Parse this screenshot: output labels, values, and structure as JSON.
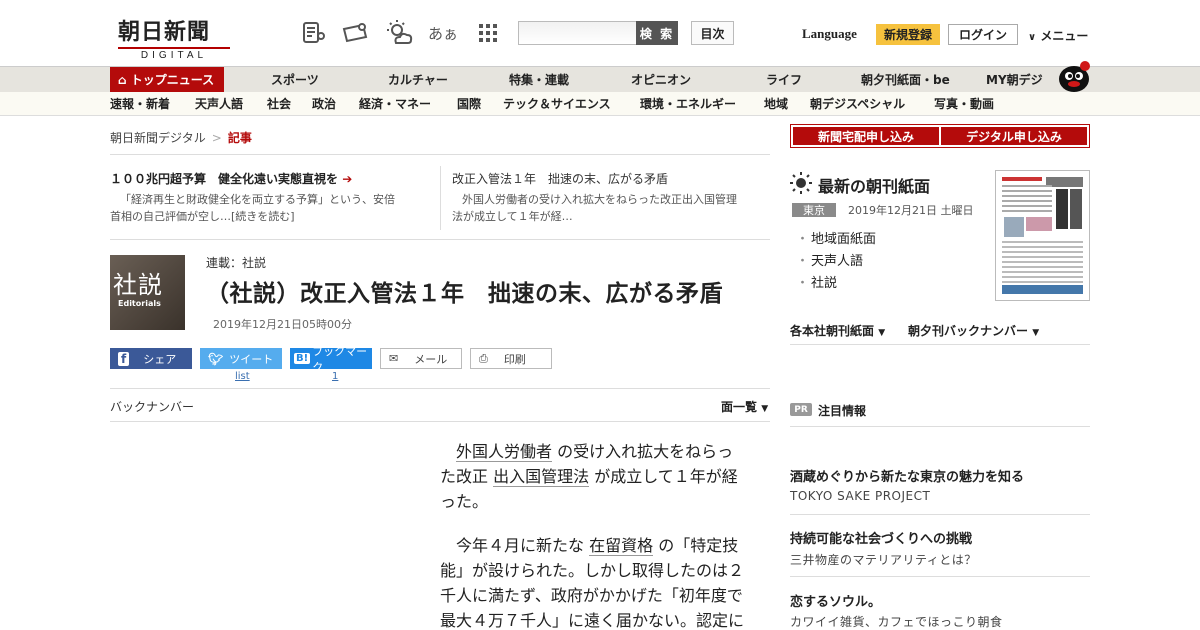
{
  "header": {
    "logo_main": "朝日新聞",
    "logo_sub": "DIGITAL",
    "aa_label": "あぁ",
    "search_placeholder": "",
    "search_button": "検 索",
    "toc_button": "目次",
    "language": "Language",
    "register": "新規登録",
    "login": "ログイン",
    "menu": "メニュー"
  },
  "nav": {
    "primary": [
      "トップニュース",
      "スポーツ",
      "カルチャー",
      "特集・連載",
      "オピニオン",
      "ライフ",
      "朝夕刊紙面・be",
      "MY朝デジ"
    ],
    "secondary": [
      "速報・新着",
      "天声人語",
      "社会",
      "政治",
      "経済・マネー",
      "国際",
      "テック＆サイエンス",
      "環境・エネルギー",
      "地域",
      "朝デジスペシャル",
      "写真・動画"
    ]
  },
  "breadcrumb": {
    "home": "朝日新聞デジタル",
    "sep": ">",
    "current": "記事"
  },
  "related": [
    {
      "title": "１００兆円超予算　健全化遠い実態直視を",
      "desc1": "「経済再生と財政健全化を両立する予算」という、安倍",
      "desc2": "首相の自己評価が空し…[続きを読む]"
    },
    {
      "title": "改正入管法１年　拙速の末、広がる矛盾",
      "desc1": "外国人労働者の受け入れ拡大をねらった改正出入国管理",
      "desc2": "法が成立して１年が経…"
    }
  ],
  "article": {
    "thumb_kanji": "社説",
    "thumb_en": "Editorials",
    "series": "連載：社説",
    "headline": "（社説）改正入管法１年　拙速の末、広がる矛盾",
    "date": "2019年12月21日05時00分",
    "share": {
      "facebook": "シェア",
      "twitter": "ツイート",
      "twitter_count": "list",
      "hatena_icon": "B!",
      "hatena": "ブックマーク",
      "hatena_count": "1",
      "mail": "メール",
      "print": "印刷"
    },
    "backnumber": "バックナンバー",
    "menu_list": "面一覧",
    "body": {
      "p1_a": "外国人労働者",
      "p1_b": "の受け入れ拡大をねらった改正",
      "p1_c": "出入国管理法",
      "p1_d": "が成立して１年が経った。",
      "p2_a": "今年４月に新たな",
      "p2_b": "在留資格",
      "p2_c": "の「特定技能」が設けられた。しかし取得したのは２千人に満たず、政府がかかげた「初年度で最大４万７千人」に遠く届かない。認定に"
    }
  },
  "sidebar": {
    "subscribe_print": "新聞宅配申し込み",
    "subscribe_digital": "デジタル申し込み",
    "paper_title": "最新の朝刊紙面",
    "region": "東京",
    "paper_date": "2019年12月21日 土曜日",
    "paper_links": [
      "地域面紙面",
      "天声人語",
      "社説"
    ],
    "dropdowns": [
      "各本社朝刊紙面",
      "朝夕刊バックナンバー"
    ],
    "pr_badge": "PR",
    "pr_label": "注目情報",
    "ads": [
      {
        "title": "酒蔵めぐりから新たな東京の魅力を知る",
        "sub": "TOKYO SAKE PROJECT"
      },
      {
        "title": "持続可能な社会づくりへの挑戦",
        "sub": "三井物産のマテリアリティとは？"
      },
      {
        "title": "恋するソウル。",
        "sub": "カワイイ雑貨、カフェでほっこり朝食"
      }
    ]
  },
  "colors": {
    "brand_red": "#b40b0b",
    "register_yellow": "#f6c23e",
    "facebook": "#3b5998",
    "twitter": "#55acee",
    "hatena": "#1e88e5"
  }
}
